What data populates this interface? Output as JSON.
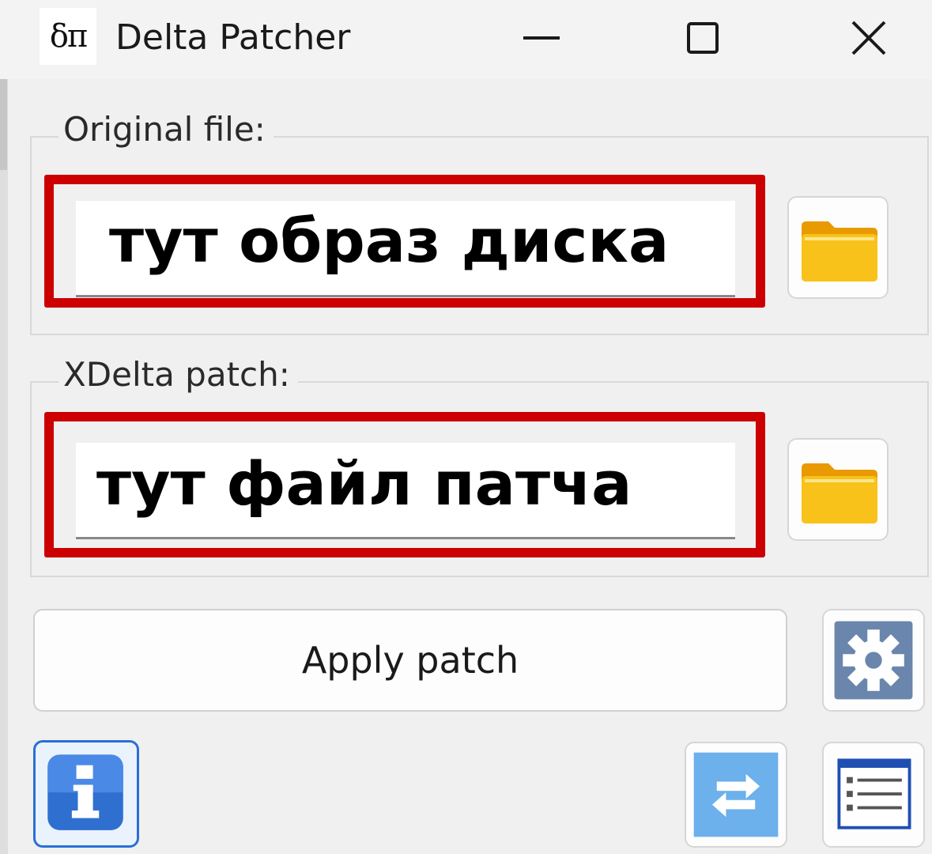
{
  "window": {
    "icon_text": "δπ",
    "title": "Delta Patcher"
  },
  "original_group": {
    "label": "Original file:",
    "value": "тут образ диска"
  },
  "patch_group": {
    "label": "XDelta patch:",
    "value": "тут файл патча"
  },
  "actions": {
    "apply_label": "Apply patch"
  },
  "icons": {
    "minimize": "minimize-icon",
    "maximize": "maximize-icon",
    "close": "close-icon",
    "browse": "folder-icon",
    "settings": "gear-icon",
    "info": "info-icon",
    "swap": "swap-arrows-icon",
    "log": "log-list-icon"
  },
  "colors": {
    "highlight": "#cc0000",
    "folder": "#f5b400",
    "info_blue": "#2f6fd0",
    "gear_blue": "#6b86ad",
    "swap_blue": "#6cb0ec"
  }
}
